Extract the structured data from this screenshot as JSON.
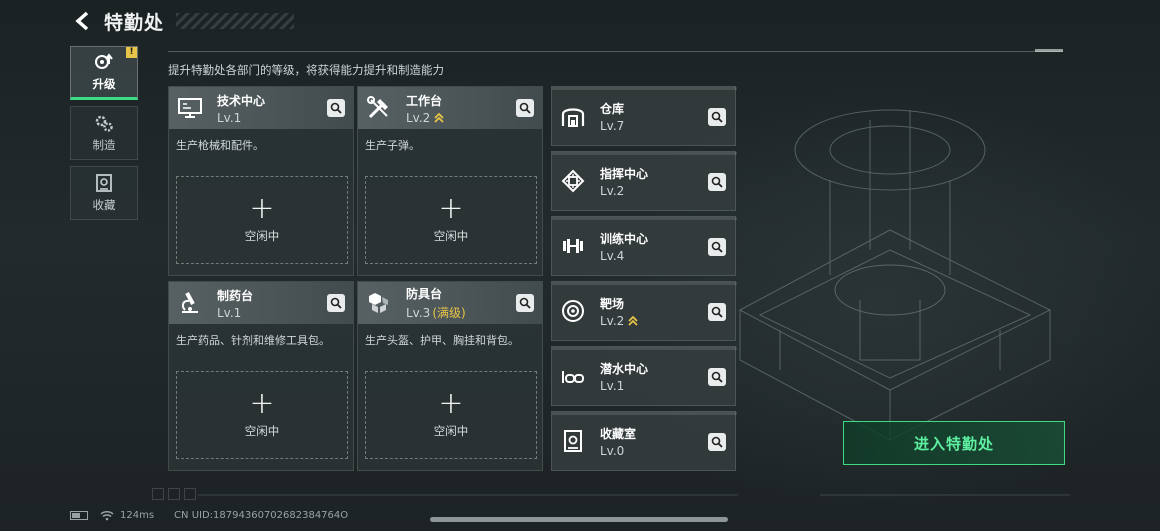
{
  "header": {
    "title": "特勤处"
  },
  "subtitle": "提升特勤处各部门的等级，将获得能力提升和制造能力",
  "sidebar": {
    "tabs": [
      {
        "label": "升级",
        "icon": "upgrade-icon",
        "active": true,
        "badge": "!"
      },
      {
        "label": "制造",
        "icon": "gears-icon",
        "active": false
      },
      {
        "label": "收藏",
        "icon": "collection-icon",
        "active": false
      }
    ]
  },
  "workshops": [
    {
      "name": "技术中心",
      "level": "Lv.1",
      "desc": "生产枪械和配件。",
      "slot": {
        "plus": "+",
        "label": "空闲中"
      }
    },
    {
      "name": "工作台",
      "level": "Lv.2",
      "upgradable": true,
      "desc": "生产子弹。",
      "slot": {
        "plus": "+",
        "label": "空闲中"
      }
    },
    {
      "name": "制药台",
      "level": "Lv.1",
      "desc": "生产药品、针剂和维修工具包。",
      "slot": {
        "plus": "+",
        "label": "空闲中"
      }
    },
    {
      "name": "防具台",
      "level": "Lv.3",
      "max_tag": "(满级)",
      "desc": "生产头盔、护甲、胸挂和背包。",
      "slot": {
        "plus": "+",
        "label": "空闲中"
      }
    }
  ],
  "buildings": [
    {
      "name": "仓库",
      "level": "Lv.7"
    },
    {
      "name": "指挥中心",
      "level": "Lv.2"
    },
    {
      "name": "训练中心",
      "level": "Lv.4"
    },
    {
      "name": "靶场",
      "level": "Lv.2",
      "upgradable": true
    },
    {
      "name": "潜水中心",
      "level": "Lv.1"
    },
    {
      "name": "收藏室",
      "level": "Lv.0"
    }
  ],
  "enter_button": "进入特勤处",
  "status_bar": {
    "ping": "124ms",
    "uid": "CN UID:18794360702682384764O"
  },
  "colors": {
    "accent": "#3ddc84",
    "gold": "#e8c547"
  }
}
